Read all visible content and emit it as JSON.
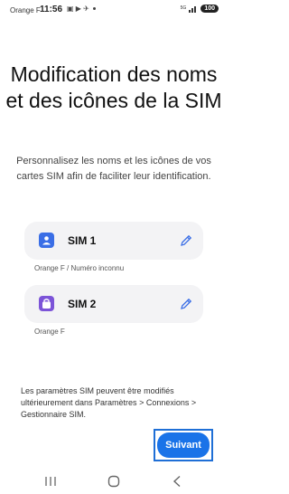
{
  "status_bar": {
    "carrier": "Orange F",
    "time": "11:56",
    "notif_icons": "▣ ▶ ✈",
    "network": "5G",
    "battery": "100"
  },
  "title": "Modification des noms et des icônes de la SIM",
  "subtitle": "Personnalisez les noms et les icônes de vos cartes SIM afin de faciliter leur identification.",
  "sims": [
    {
      "name": "SIM 1",
      "caption": "Orange F / Numéro inconnu",
      "icon": "person-icon",
      "color": "#3a6ee6"
    },
    {
      "name": "SIM 2",
      "caption": "Orange F",
      "icon": "bag-icon",
      "color": "#7c54d8"
    }
  ],
  "footer_note": "Les paramètres SIM peuvent être modifiés ultérieurement dans Paramètres > Connexions > Gestionnaire SIM.",
  "next_button": "Suivant",
  "accent_color": "#1a73e8"
}
